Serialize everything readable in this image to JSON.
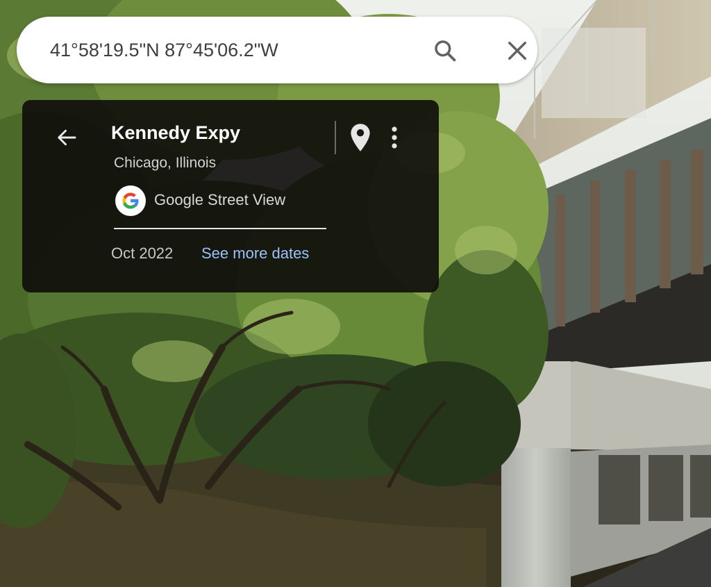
{
  "search": {
    "value": "41°58'19.5\"N 87°45'06.2\"W",
    "search_icon": "search-icon",
    "close_icon": "close-icon"
  },
  "card": {
    "back_icon": "arrow-back-icon",
    "title": "Kennedy Expy",
    "subtitle": "Chicago, Illinois",
    "pin_icon": "map-pin-icon",
    "more_icon": "more-vert-icon",
    "source_logo": "google-logo",
    "source_label": "Google Street View",
    "date": "Oct 2022",
    "see_more_label": "See more dates"
  },
  "colors": {
    "link": "#9ac2f9",
    "card_bg": "#0e0c0a",
    "google_blue": "#4285F4",
    "google_red": "#EA4335",
    "google_yellow": "#FBBC05",
    "google_green": "#34A853"
  }
}
